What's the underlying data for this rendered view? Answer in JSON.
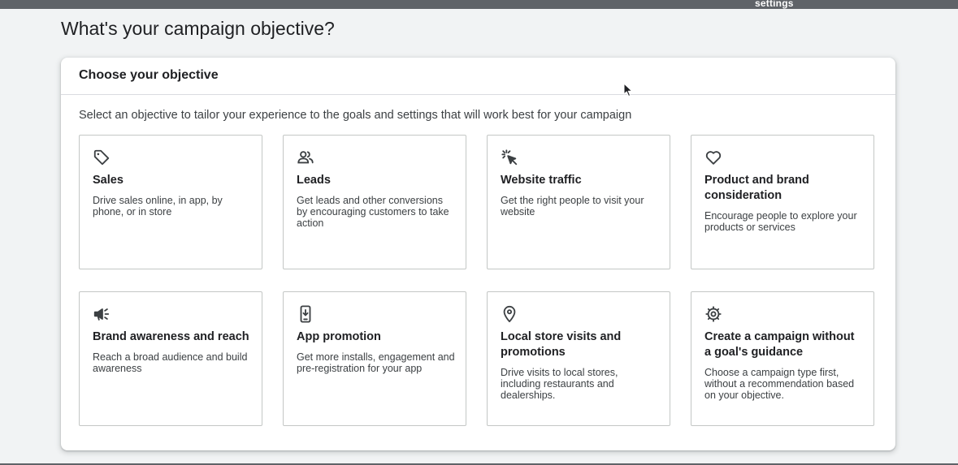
{
  "top_strip": {
    "label": "settings"
  },
  "page": {
    "title": "What's your campaign objective?"
  },
  "card": {
    "header_title": "Choose your objective",
    "description": "Select an objective to tailor your experience to the goals and settings that will work best for your campaign"
  },
  "objectives": [
    {
      "icon": "tag-icon",
      "title": "Sales",
      "description": "Drive sales online, in app, by phone, or in store"
    },
    {
      "icon": "people-icon",
      "title": "Leads",
      "description": "Get leads and other conversions by encouraging customers to take action"
    },
    {
      "icon": "click-cursor-icon",
      "title": "Website traffic",
      "description": "Get the right people to visit your website"
    },
    {
      "icon": "heart-icon",
      "title": "Product and brand consideration",
      "description": "Encourage people to explore your products or services"
    },
    {
      "icon": "megaphone-icon",
      "title": "Brand awareness and reach",
      "description": "Reach a broad audience and build awareness"
    },
    {
      "icon": "phone-download-icon",
      "title": "App promotion",
      "description": "Get more installs, engagement and pre-registration for your app"
    },
    {
      "icon": "location-pin-icon",
      "title": "Local store visits and promotions",
      "description": "Drive visits to local stores, including restaurants and dealerships."
    },
    {
      "icon": "gear-icon",
      "title": "Create a campaign without a goal's guidance",
      "description": "Choose a campaign type first, without a recommendation based on your objective."
    }
  ],
  "colors": {
    "background": "#f1f3f4",
    "card": "#ffffff",
    "tile_border": "#c4c7c5",
    "text_primary": "#202124",
    "text_secondary": "#3c4043",
    "top_strip": "#5f6368"
  }
}
